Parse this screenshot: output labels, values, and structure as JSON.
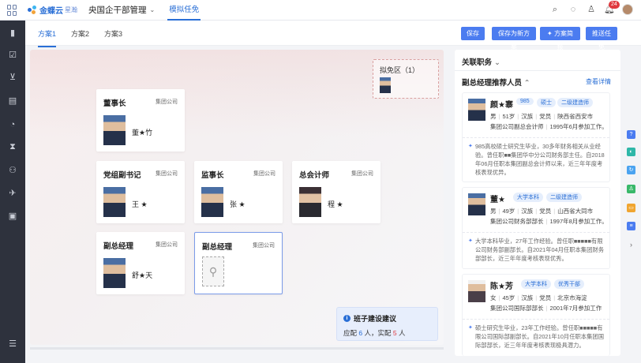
{
  "topbar": {
    "logo_main": "金蝶云",
    "logo_sub": "星瀚",
    "menu_label": "央国企干部管理",
    "nav_tab": "模拟任免",
    "notification_count": "24"
  },
  "tabs": [
    "方案1",
    "方案2",
    "方案3"
  ],
  "actions": {
    "save": "保存",
    "save_as": "保存为新方案",
    "brief": "方案简报",
    "push": "推送任免"
  },
  "pending": {
    "label": "拟免区（1）"
  },
  "cards": [
    {
      "title": "董事长",
      "org": "集团公司",
      "name": "董★竹"
    },
    {
      "title": "党组副书记",
      "org": "集团公司",
      "name": "王 ★"
    },
    {
      "title": "监事长",
      "org": "集团公司",
      "name": "张 ★"
    },
    {
      "title": "总会计师",
      "org": "集团公司",
      "name": "程 ★"
    },
    {
      "title": "副总经理",
      "org": "集团公司",
      "name": "舒★天"
    },
    {
      "title": "副总经理",
      "org": "集团公司",
      "name": ""
    }
  ],
  "advice": {
    "title": "班子建设建议",
    "prefix": "应配",
    "should": "6",
    "mid": "人，实配",
    "actual": "5",
    "suffix": "人"
  },
  "right_panel": {
    "header": "关联职务",
    "section": "副总经理推荐人员",
    "more": "查看详情",
    "candidates": [
      {
        "name": "颜★寨",
        "tags": [
          "985",
          "硕士",
          "二级建造师"
        ],
        "gender": "男",
        "age": "51岁",
        "ethnic": "汉族",
        "party": "党员",
        "place": "陕西省西安市",
        "position": "集团公司副总会计师",
        "work_start": "1995年6月参加工作。",
        "desc": "985高校硕士研究生毕业，30多年财务相关从业经验。曾任职■■集团华中分公司财务部主任。自2018年06月任职本集团副总会计师以来，近三年年度考核表现优异。"
      },
      {
        "name": "董★",
        "tags": [
          "大学本科",
          "二级建造师"
        ],
        "gender": "男",
        "age": "49岁",
        "ethnic": "汉族",
        "party": "党员",
        "place": "山西省大同市",
        "position": "集团公司财务部部长",
        "work_start": "1997年8月参加工作。",
        "desc": "大学本科毕业，27年工作经验。曾任职■■■■■有限公司财务部副部长。自2021年04月任职本集团财务部部长，近三年年度考核表现优秀。"
      },
      {
        "name": "陈★芳",
        "tags": [
          "大学本科",
          "优秀干部"
        ],
        "gender": "女",
        "age": "45岁",
        "ethnic": "汉族",
        "party": "党员",
        "place": "北京市海淀",
        "position": "集团公司国际部部长",
        "work_start": "2001年7月参加工作",
        "desc": "硕士研究生毕业，23年工作经验。曾任职■■■■■有限公司国际部副部长。自2021年10月任职本集团国际部部长，近三年年度考核表现极具潜力。"
      }
    ]
  }
}
